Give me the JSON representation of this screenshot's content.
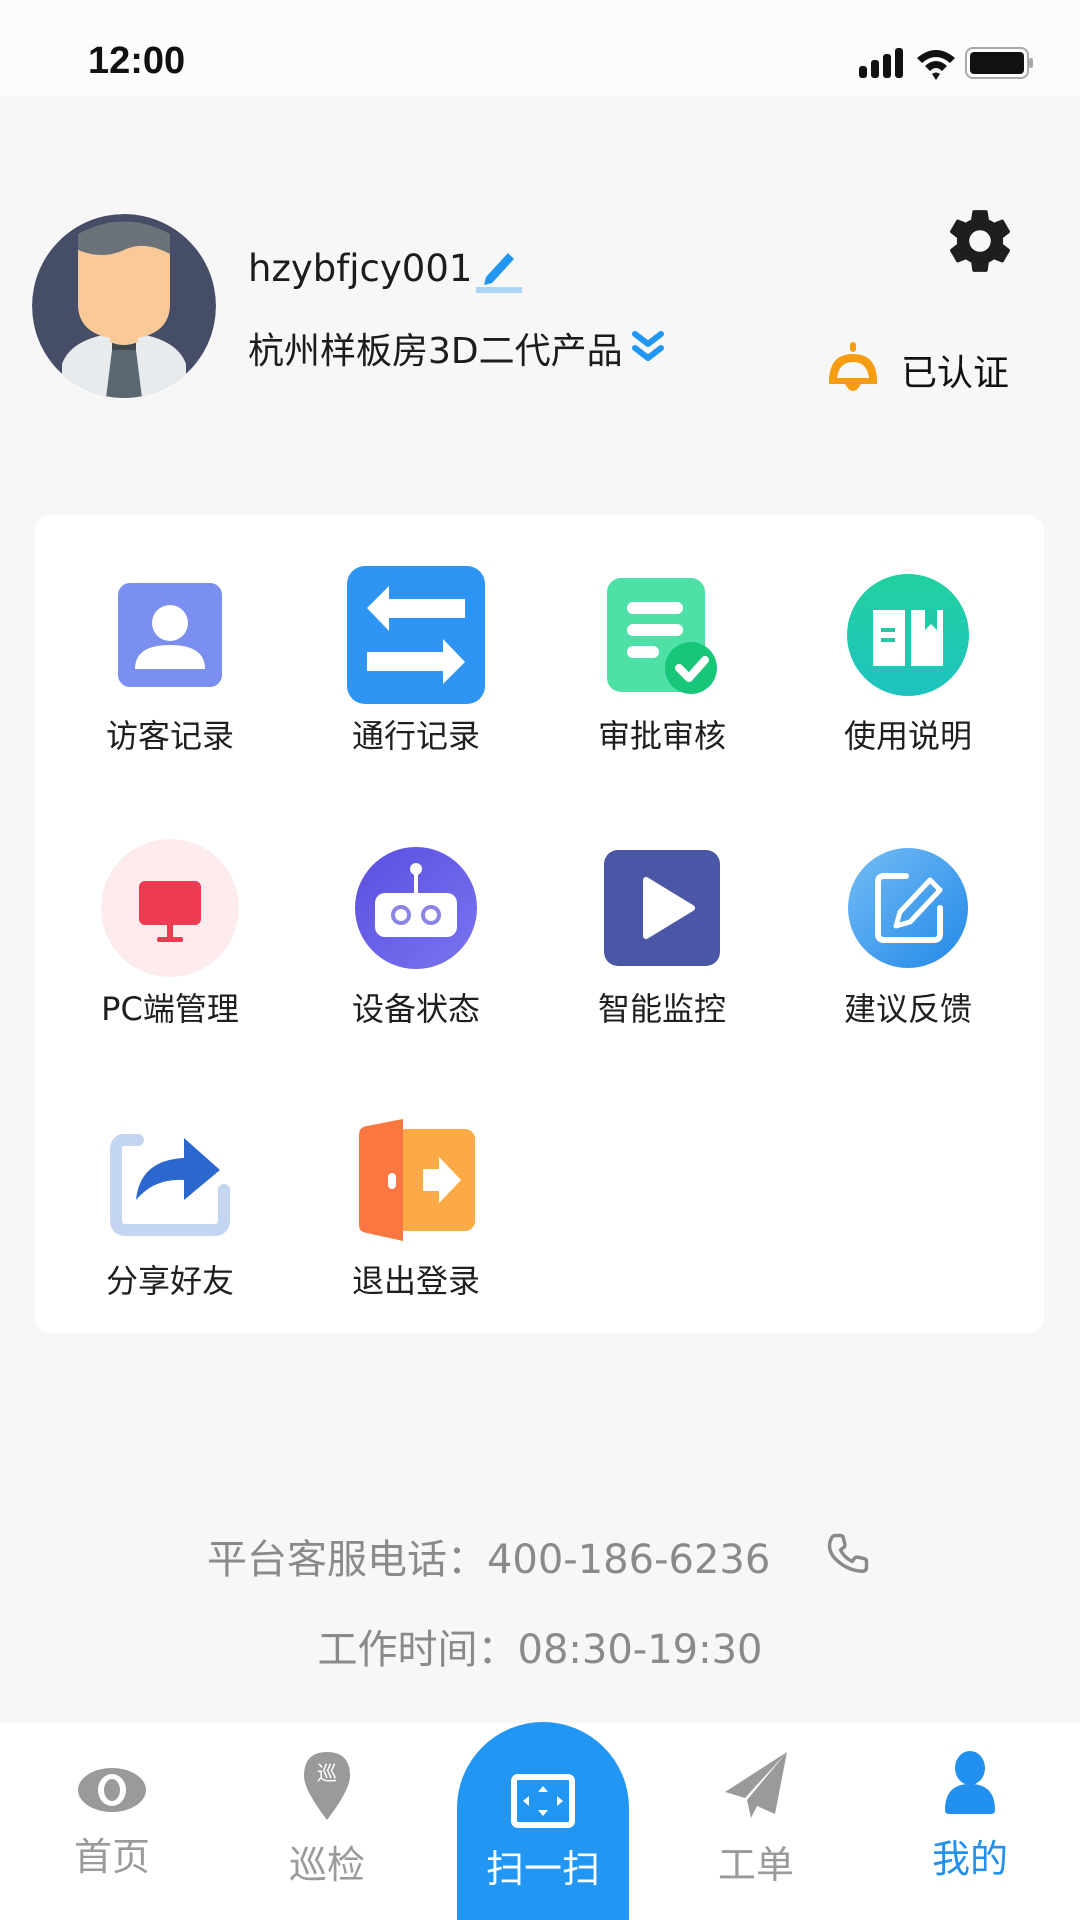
{
  "status_bar": {
    "time": "12:00",
    "icons": [
      "signal-icon",
      "wifi-icon",
      "battery-icon"
    ]
  },
  "profile": {
    "username": "hzybfjcy001",
    "edit_icon": "pencil-icon",
    "company": "杭州样板房3D二代产品",
    "company_switch_icon": "double-chevron-down-icon",
    "settings_icon": "gear-icon",
    "certification": {
      "icon": "bell-icon",
      "label": "已认证"
    }
  },
  "menu": [
    {
      "id": "visitor-records",
      "label": "访客记录",
      "icon": "visitor-icon"
    },
    {
      "id": "pass-records",
      "label": "通行记录",
      "icon": "transfer-arrows-icon"
    },
    {
      "id": "approval",
      "label": "审批审核",
      "icon": "document-check-icon"
    },
    {
      "id": "manual",
      "label": "使用说明",
      "icon": "book-icon"
    },
    {
      "id": "pc-management",
      "label": "PC端管理",
      "icon": "monitor-icon"
    },
    {
      "id": "device-status",
      "label": "设备状态",
      "icon": "robot-icon"
    },
    {
      "id": "smart-monitoring",
      "label": "智能监控",
      "icon": "play-icon"
    },
    {
      "id": "feedback",
      "label": "建议反馈",
      "icon": "edit-note-icon"
    },
    {
      "id": "share-friends",
      "label": "分享好友",
      "icon": "share-icon"
    },
    {
      "id": "logout",
      "label": "退出登录",
      "icon": "exit-door-icon"
    }
  ],
  "contact": {
    "phone_label": "平台客服电话：",
    "phone": "400-186-6236",
    "phone_icon": "phone-icon",
    "hours_label": "工作时间：",
    "hours": "08:30-19:30"
  },
  "bottom_nav": [
    {
      "label": "首页",
      "icon": "eye-icon",
      "active": false
    },
    {
      "label": "巡检",
      "icon": "patrol-pin-icon",
      "active": false
    },
    {
      "label": "扫一扫",
      "icon": "scan-icon",
      "active": false
    },
    {
      "label": "工单",
      "icon": "paper-plane-icon",
      "active": false
    },
    {
      "label": "我的",
      "icon": "user-icon",
      "active": true
    }
  ],
  "colors": {
    "accent": "#2196f3",
    "active_tab": "#2190ee",
    "inactive_tab": "#9a9a9a",
    "cert_bell": "#f59c12"
  }
}
